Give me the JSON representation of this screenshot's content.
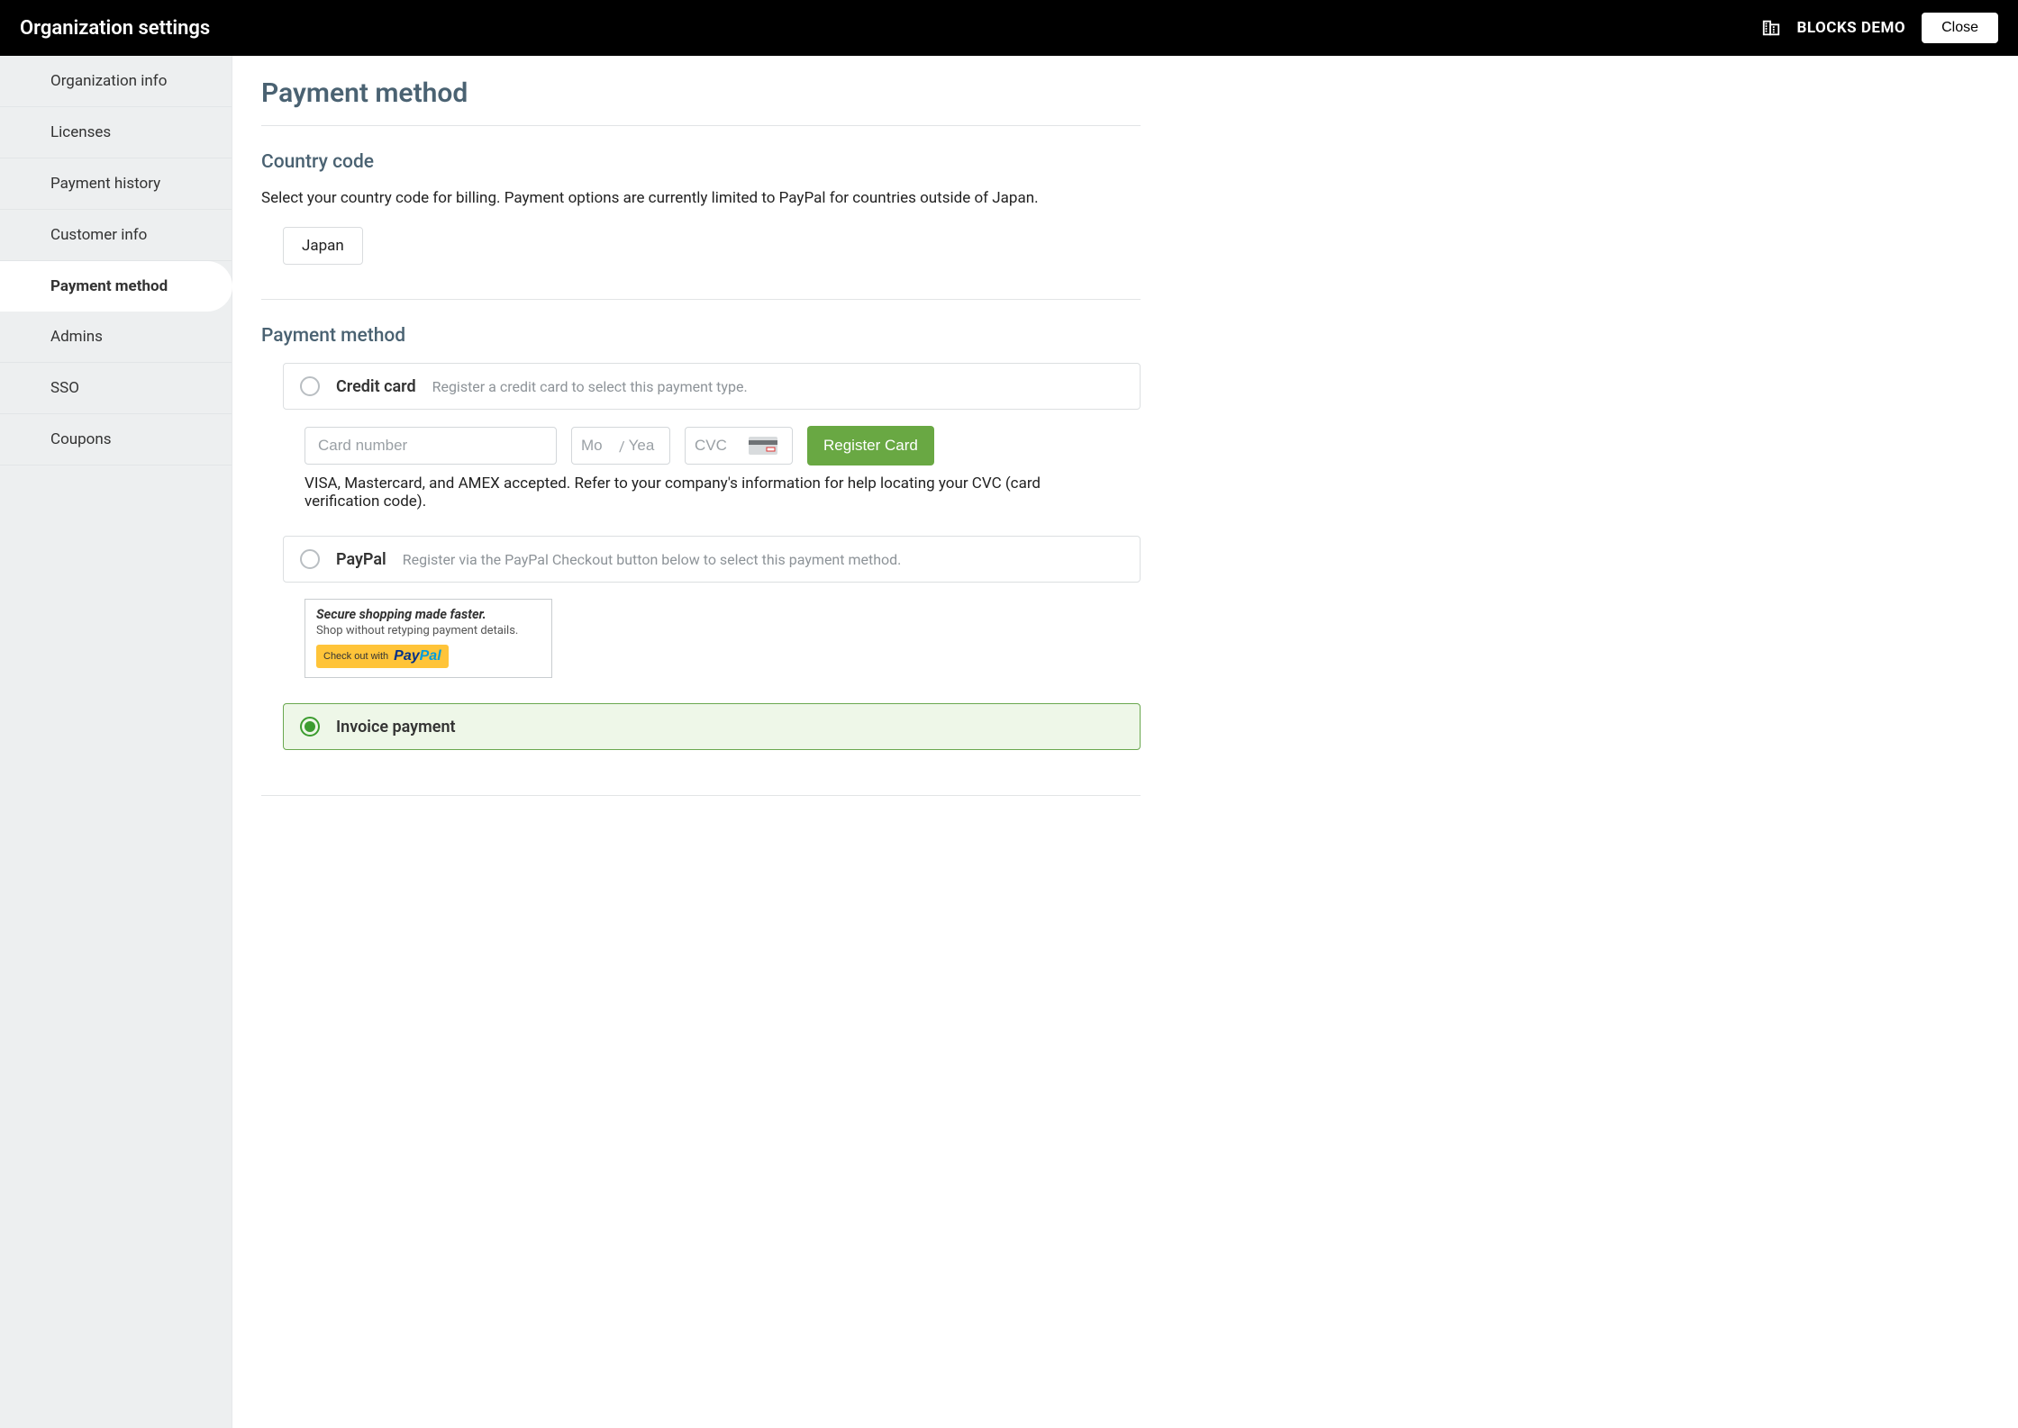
{
  "header": {
    "title": "Organization settings",
    "org_name": "BLOCKS DEMO",
    "close_label": "Close"
  },
  "sidebar": {
    "items": [
      {
        "label": "Organization info",
        "active": false
      },
      {
        "label": "Licenses",
        "active": false
      },
      {
        "label": "Payment history",
        "active": false
      },
      {
        "label": "Customer info",
        "active": false
      },
      {
        "label": "Payment method",
        "active": true
      },
      {
        "label": "Admins",
        "active": false
      },
      {
        "label": "SSO",
        "active": false
      },
      {
        "label": "Coupons",
        "active": false
      }
    ]
  },
  "page": {
    "title": "Payment method",
    "country": {
      "heading": "Country code",
      "description": "Select your country code for billing. Payment options are currently limited to PayPal for countries outside of Japan.",
      "selected": "Japan"
    },
    "method": {
      "heading": "Payment method",
      "credit_card": {
        "label": "Credit card",
        "hint": "Register a credit card to select this payment type.",
        "placeholders": {
          "card_number": "Card number",
          "month": "Mo",
          "year": "Yea",
          "cvc": "CVC"
        },
        "register_label": "Register Card",
        "note": "VISA, Mastercard, and AMEX accepted. Refer to your company's information for help locating your CVC (card verification code)."
      },
      "paypal": {
        "label": "PayPal",
        "hint": "Register via the PayPal Checkout button below to select this payment method.",
        "popup": {
          "title": "Secure shopping made faster.",
          "subtitle": "Shop without retyping payment details.",
          "button_prefix": "Check out with",
          "brand_a": "Pay",
          "brand_b": "Pal"
        }
      },
      "invoice": {
        "label": "Invoice payment"
      },
      "selected": "invoice"
    }
  }
}
